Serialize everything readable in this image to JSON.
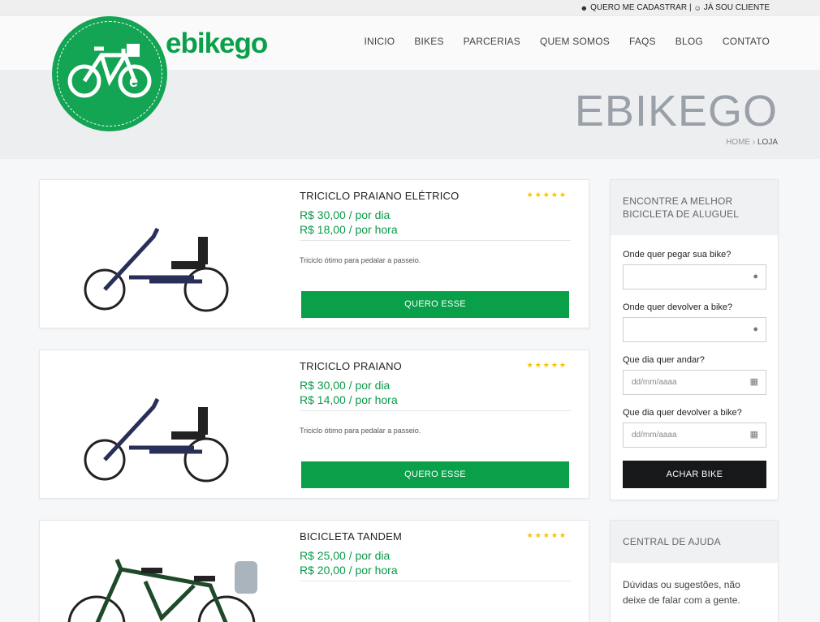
{
  "topbar": {
    "register": "QUERO ME CADASTRAR",
    "divider": "|",
    "login": "JÁ SOU CLIENTE"
  },
  "brand": {
    "name": "ebikego"
  },
  "nav": [
    "INICIO",
    "BIKES",
    "PARCERIAS",
    "QUEM SOMOS",
    "FAQS",
    "BLOG",
    "CONTATO"
  ],
  "hero": {
    "title": "EBIKEGO",
    "breadcrumb_home": "HOME",
    "breadcrumb_sep": "›",
    "breadcrumb_current": "LOJA"
  },
  "products": [
    {
      "name": "TRICICLO PRAIANO ELÉTRICO",
      "rating": 5,
      "price_day": "R$ 30,00 / por dia",
      "price_hour": "R$ 18,00 / por hora",
      "description": "Triciclo ótimo para pedalar a passeio.",
      "button": "QUERO ESSE"
    },
    {
      "name": "TRICICLO PRAIANO",
      "rating": 5,
      "price_day": "R$ 30,00 / por dia",
      "price_hour": "R$ 14,00 / por hora",
      "description": "Triciclo ótimo para pedalar a passeio.",
      "button": "QUERO ESSE"
    },
    {
      "name": "BICICLETA TANDEM",
      "rating": 5,
      "price_day": "R$ 25,00 / por dia",
      "price_hour": "R$ 20,00 / por hora"
    }
  ],
  "search": {
    "title": "ENCONTRE A MELHOR BICICLETA DE ALUGUEL",
    "pickup_label": "Onde quer pegar sua bike?",
    "return_label": "Onde quer devolver a bike?",
    "start_label": "Que dia quer andar?",
    "start_placeholder": "dd/mm/aaaa",
    "end_label": "Que dia quer devolver a bike?",
    "end_placeholder": "dd/mm/aaaa",
    "button": "ACHAR BIKE"
  },
  "help": {
    "title": "CENTRAL DE AJUDA",
    "text": "Dúvidas ou sugestões, não deixe de falar com a gente."
  },
  "colors": {
    "brand_green": "#0aa04a",
    "dark": "#16181a",
    "star": "#f2c200"
  },
  "icons": [
    "user-plus-icon",
    "user-icon",
    "map-marker-icon",
    "calendar-icon",
    "star-icon",
    "bike-logo-icon"
  ]
}
